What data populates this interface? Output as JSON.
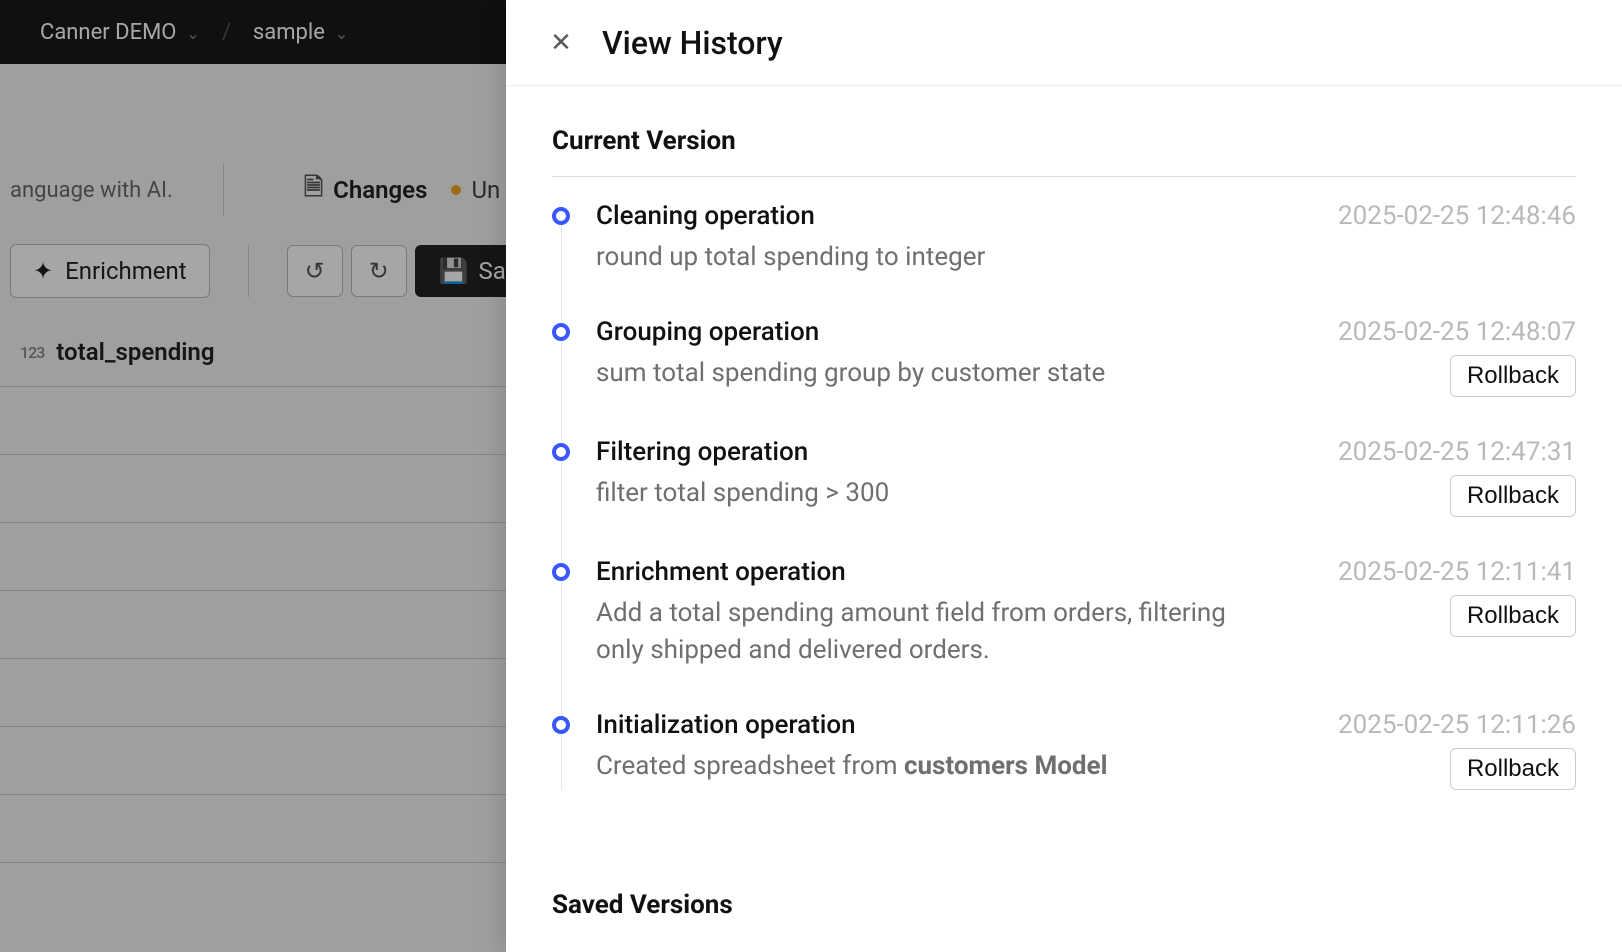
{
  "breadcrumb": {
    "org": "Canner DEMO",
    "project": "sample"
  },
  "bg": {
    "ai_text": "anguage with AI.",
    "changes_label": "Changes",
    "unsaved_prefix": "Un",
    "enrichment_label": "Enrichment",
    "save_prefix": "Sa",
    "column_label": "total_spending",
    "col_type": "123"
  },
  "drawer": {
    "title": "View History",
    "current_section": "Current Version",
    "saved_section": "Saved Versions",
    "rollback_label": "Rollback",
    "entries": [
      {
        "title": "Cleaning operation",
        "desc": "round up total spending to integer",
        "time": "2025-02-25 12:48:46",
        "rollback": false
      },
      {
        "title": "Grouping operation",
        "desc": "sum total spending group by customer state",
        "time": "2025-02-25 12:48:07",
        "rollback": true
      },
      {
        "title": "Filtering operation",
        "desc": "filter total spending > 300",
        "time": "2025-02-25 12:47:31",
        "rollback": true
      },
      {
        "title": "Enrichment operation",
        "desc": "Add a total spending amount field from orders, filtering only shipped and delivered orders.",
        "time": "2025-02-25 12:11:41",
        "rollback": true
      },
      {
        "title": "Initialization operation",
        "desc_prefix": "Created spreadsheet from ",
        "desc_bold": "customers Model",
        "time": "2025-02-25 12:11:26",
        "rollback": true
      }
    ]
  }
}
